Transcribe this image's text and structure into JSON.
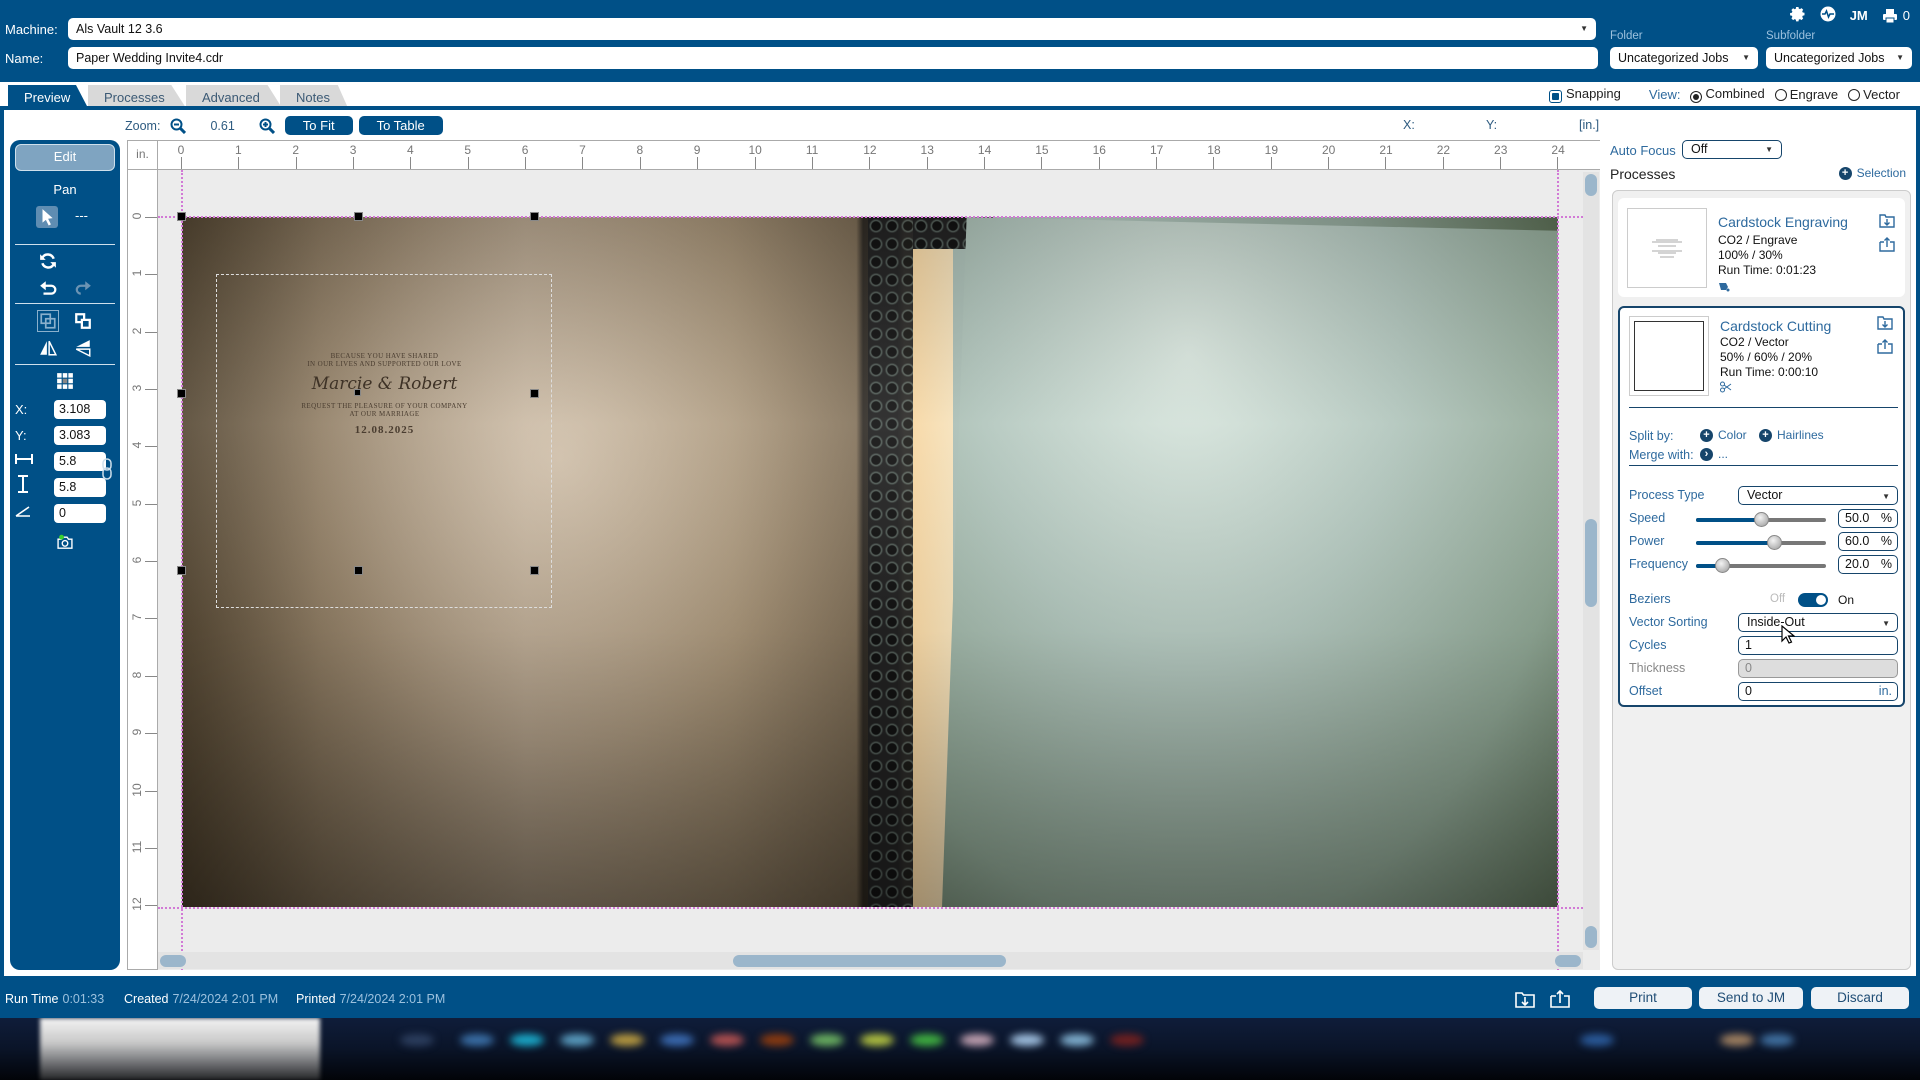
{
  "header": {
    "machine_label": "Machine:",
    "machine_value": "Als Vault 12 3.6",
    "name_label": "Name:",
    "name_value": "Paper Wedding Invite4.cdr",
    "folder_label": "Folder",
    "folder_value": "Uncategorized Jobs",
    "subfolder_label": "Subfolder",
    "subfolder_value": "Uncategorized Jobs",
    "icons": [
      "gear-icon",
      "activity-icon",
      "job-manager-icon",
      "printer-icon"
    ],
    "jm_label": "JM",
    "print_queue_count": "0"
  },
  "tabs": [
    {
      "label": "Preview",
      "active": true
    },
    {
      "label": "Processes",
      "active": false
    },
    {
      "label": "Advanced",
      "active": false
    },
    {
      "label": "Notes",
      "active": false
    }
  ],
  "view_options": {
    "snapping_label": "Snapping",
    "snapping_checked": true,
    "view_label": "View:",
    "modes": [
      {
        "label": "Combined",
        "selected": true
      },
      {
        "label": "Engrave",
        "selected": false
      },
      {
        "label": "Vector",
        "selected": false
      }
    ]
  },
  "zoom": {
    "label": "Zoom:",
    "value": "0.61",
    "to_fit_label": "To Fit",
    "to_table_label": "To Table"
  },
  "cursor_readout": {
    "x_label": "X:",
    "y_label": "Y:",
    "unit_label": "[in.]"
  },
  "toolbar": {
    "edit_label": "Edit",
    "pan_label": "Pan",
    "select_mode_label": "---",
    "x_label": "X:",
    "x_value": "3.108",
    "y_label": "Y:",
    "y_value": "3.083",
    "width_value": "5.8",
    "height_value": "5.8",
    "angle_value": "0"
  },
  "ruler": {
    "unit": "in.",
    "h_ticks": [
      "0",
      "1",
      "2",
      "3",
      "4",
      "5",
      "6",
      "7",
      "8",
      "9",
      "10",
      "11",
      "12",
      "13",
      "14",
      "15",
      "16",
      "17",
      "18",
      "19",
      "20",
      "21",
      "22",
      "23",
      "24"
    ],
    "v_ticks": [
      "0",
      "1",
      "2",
      "3",
      "4",
      "5",
      "6",
      "7",
      "8",
      "9",
      "10",
      "11",
      "12"
    ]
  },
  "artwork": {
    "line1": "BECAUSE YOU HAVE SHARED",
    "line2": "IN OUR LIVES AND SUPPORTED OUR LOVE",
    "names": "Marcie & Robert",
    "line3": "REQUEST THE PLEASURE OF YOUR COMPANY",
    "line4": "AT OUR MARRIAGE",
    "date": "12.08.2025"
  },
  "right_panel": {
    "auto_focus_label": "Auto Focus",
    "auto_focus_value": "Off",
    "processes_title": "Processes",
    "selection_label": "Selection",
    "processes": [
      {
        "name": "Cardstock Engraving",
        "type": "CO2 / Engrave",
        "settings": "100%  / 30%",
        "run_time": "Run Time: 0:01:23",
        "icon": "engrave-icon",
        "selected": false
      },
      {
        "name": "Cardstock Cutting",
        "type": "CO2 / Vector",
        "settings": "50%  / 60%  / 20%",
        "run_time": "Run Time: 0:00:10",
        "icon": "scissors-icon",
        "selected": true
      }
    ],
    "split_by_label": "Split by:",
    "split_color_label": "Color",
    "split_hairlines_label": "Hairlines",
    "merge_with_label": "Merge with:",
    "merge_with_value": "...",
    "process_type_label": "Process Type",
    "process_type_value": "Vector",
    "speed_label": "Speed",
    "speed_value": "50.0",
    "speed_fraction": 0.5,
    "power_label": "Power",
    "power_value": "60.0",
    "power_fraction": 0.6,
    "frequency_label": "Frequency",
    "frequency_value": "20.0",
    "frequency_fraction": 0.2,
    "percent_unit": "%",
    "beziers_label": "Beziers",
    "beziers_off_label": "Off",
    "beziers_on_label": "On",
    "beziers_on": true,
    "vector_sorting_label": "Vector Sorting",
    "vector_sorting_value": "Inside-Out",
    "cycles_label": "Cycles",
    "cycles_value": "1",
    "thickness_label": "Thickness",
    "thickness_value": "0",
    "offset_label": "Offset",
    "offset_value": "0",
    "offset_unit": "in."
  },
  "status_bar": {
    "run_time_label": "Run Time",
    "run_time_value": "0:01:33",
    "created_label": "Created",
    "created_value": "7/24/2024 2:01 PM",
    "printed_label": "Printed",
    "printed_value": "7/24/2024 2:01 PM"
  },
  "actions": {
    "print_label": "Print",
    "send_label": "Send to JM",
    "discard_label": "Discard"
  },
  "colors": {
    "brand_blue": "#005087",
    "guide_magenta": "#d27ad6",
    "link_blue": "#2e6a9e"
  }
}
